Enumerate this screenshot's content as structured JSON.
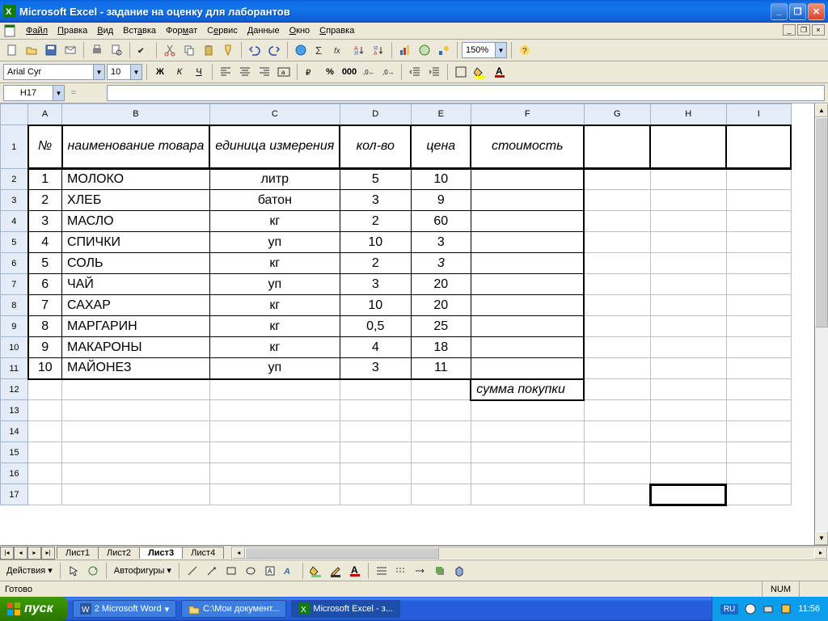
{
  "titlebar": {
    "title": "Microsoft Excel - задание на оценку для лаборантов"
  },
  "menu": {
    "file": "Файл",
    "edit": "Правка",
    "view": "Вид",
    "insert": "Вставка",
    "format": "Формат",
    "tools": "Сервис",
    "data": "Данные",
    "window": "Окно",
    "help": "Справка"
  },
  "format_toolbar": {
    "font_name": "Arial Cyr",
    "font_size": "10"
  },
  "zoom": {
    "value": "150%"
  },
  "namebox": {
    "value": "H17"
  },
  "formula": {
    "value": ""
  },
  "columns": [
    "A",
    "B",
    "C",
    "D",
    "E",
    "F",
    "G",
    "H",
    "I"
  ],
  "row_count": 17,
  "headers": {
    "num": "№",
    "name": "наименование товара",
    "unit": "единица измерения",
    "qty": "кол-во",
    "price": "цена",
    "cost": "стоимость"
  },
  "rows": [
    {
      "num": "1",
      "name": "МОЛОКО",
      "unit": "литр",
      "qty": "5",
      "price": "10"
    },
    {
      "num": "2",
      "name": "ХЛЕБ",
      "unit": "батон",
      "qty": "3",
      "price": "9"
    },
    {
      "num": "3",
      "name": "МАСЛО",
      "unit": "кг",
      "qty": "2",
      "price": "60"
    },
    {
      "num": "4",
      "name": "СПИЧКИ",
      "unit": "уп",
      "qty": "10",
      "price": "3"
    },
    {
      "num": "5",
      "name": "СОЛЬ",
      "unit": "кг",
      "qty": "2",
      "price": "3",
      "price_italic": true
    },
    {
      "num": "6",
      "name": "ЧАЙ",
      "unit": "уп",
      "qty": "3",
      "price": "20"
    },
    {
      "num": "7",
      "name": "САХАР",
      "unit": "кг",
      "qty": "10",
      "price": "20"
    },
    {
      "num": "8",
      "name": "МАРГАРИН",
      "unit": "кг",
      "qty": "0,5",
      "price": "25"
    },
    {
      "num": "9",
      "name": "МАКАРОНЫ",
      "unit": "кг",
      "qty": "4",
      "price": "18"
    },
    {
      "num": "10",
      "name": "МАЙОНЕЗ",
      "unit": "уп",
      "qty": "3",
      "price": "11"
    }
  ],
  "sum_label": "сумма покупки",
  "sheets": {
    "s1": "Лист1",
    "s2": "Лист2",
    "s3": "Лист3",
    "s4": "Лист4",
    "active": 2
  },
  "drawing": {
    "actions": "Действия",
    "autoshapes": "Автофигуры"
  },
  "status": {
    "ready": "Готово",
    "num": "NUM"
  },
  "taskbar": {
    "start": "пуск",
    "items": [
      "2 Microsoft Word",
      "C:\\Мои документ...",
      "Microsoft Excel - з..."
    ],
    "lang": "RU",
    "time": "11:56"
  }
}
